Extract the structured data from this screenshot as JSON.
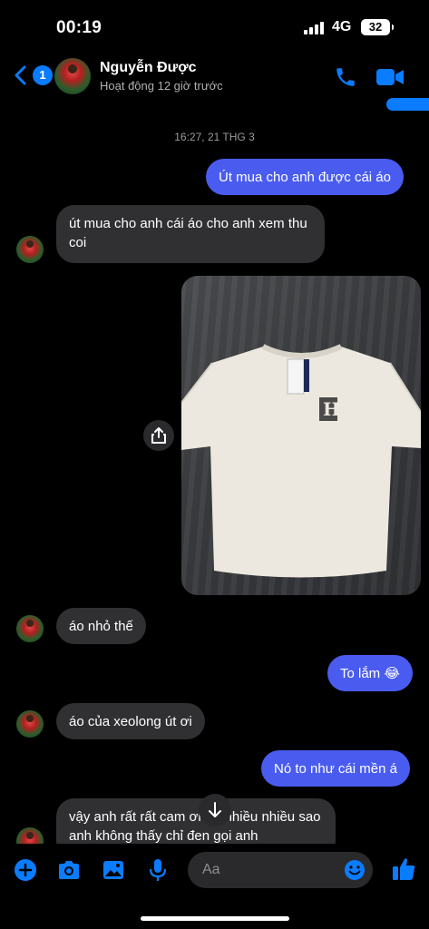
{
  "status_bar": {
    "time": "00:19",
    "network": "4G",
    "battery": "32"
  },
  "header": {
    "back_badge": "1",
    "contact_name": "Nguyễn Được",
    "contact_status": "Hoạt động 12 giờ trước"
  },
  "conversation": {
    "timestamp": "16:27, 21 THG 3",
    "messages": [
      {
        "direction": "out",
        "text": "Út mua cho anh được cái áo"
      },
      {
        "direction": "in",
        "text": "út mua cho anh cái áo cho anh xem thu coi"
      },
      {
        "direction": "out",
        "type": "photo"
      },
      {
        "direction": "in",
        "text": "áo nhỏ thế"
      },
      {
        "direction": "out",
        "text": "To lắm 😂"
      },
      {
        "direction": "in",
        "text": "áo của xeolong út ơi"
      },
      {
        "direction": "out",
        "text": "Nó to như cái mền á"
      },
      {
        "direction": "in",
        "text": "vậy anh rất rất cam ơn út nhiều nhiều sao anh không thấy chỉ đen gọi anh"
      }
    ]
  },
  "composer": {
    "placeholder": "Aa"
  },
  "colors": {
    "accent": "#0a7cff",
    "outgoing_bubble": "#4a5cf0",
    "incoming_bubble": "#303033",
    "background": "#000000"
  },
  "icons": [
    "back-chevron",
    "phone",
    "video-camera",
    "share",
    "arrow-down",
    "plus",
    "camera",
    "gallery",
    "microphone",
    "emoji",
    "thumbs-up"
  ]
}
